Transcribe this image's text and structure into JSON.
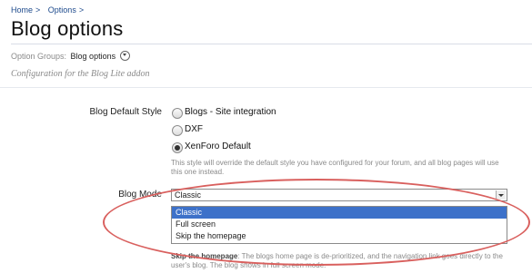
{
  "breadcrumb": {
    "items": [
      "Home",
      "Options"
    ],
    "sep": ">"
  },
  "page": {
    "title": "Blog options",
    "option_groups_label": "Option Groups:",
    "option_groups_value": "Blog options",
    "description": "Configuration for the Blog Lite addon"
  },
  "blog_style": {
    "label": "Blog Default Style",
    "options": [
      "Blogs - Site integration",
      "DXF",
      "XenForo Default"
    ],
    "selected": "XenForo Default",
    "hint": "This style will override the default style you have configured for your forum, and all blog pages will use this one instead."
  },
  "blog_mode": {
    "label": "Blog Mode",
    "value": "Classic",
    "options": [
      "Classic",
      "Full screen",
      "Skip the homepage"
    ],
    "highlighted": "Classic",
    "hint_bold": "Skip the homepage",
    "hint_rest": ": The blogs home page is de-prioritized, and the navigation link goes directly to the user's blog. The blog shows in full screen mode."
  },
  "colors": {
    "accent": "#3d71c9",
    "annotation": "#d9605e",
    "link": "#1d4a8c"
  }
}
